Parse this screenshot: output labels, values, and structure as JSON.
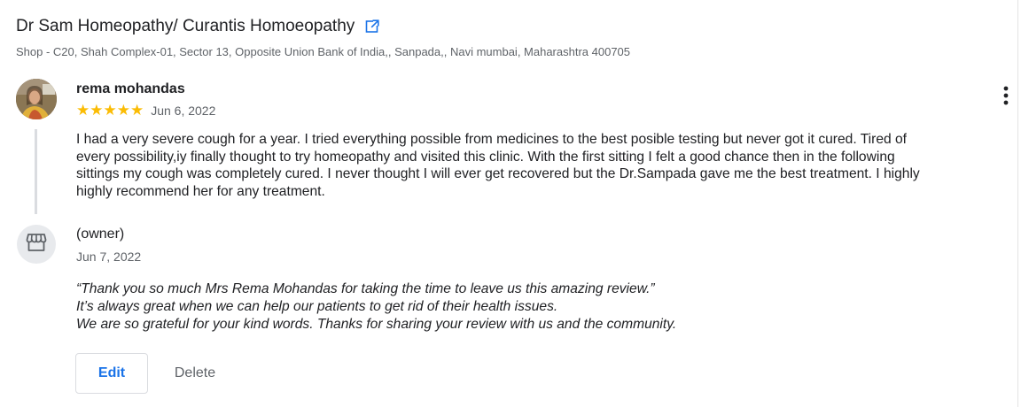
{
  "business": {
    "name": "Dr Sam Homeopathy/ Curantis Homoeopathy",
    "address": "Shop - C20, Shah Complex-01, Sector 13, Opposite Union Bank of India,, Sanpada,, Navi mumbai, Maharashtra 400705",
    "open_icon": "open-in-new-icon"
  },
  "review": {
    "reviewer_name": "rema mohandas",
    "stars_display": "★★★★★",
    "rating": 5,
    "date": "Jun 6, 2022",
    "text": "I had a very severe cough for a year. I tried everything possible from medicines to the best posible testing but never got it cured. Tired of every possibility,iy finally thought to try homeopathy and visited this clinic. With the first sitting I felt a good chance then in the following sittings my cough was completely cured. I never thought I will ever get recovered but the Dr.Sampada gave me the best treatment. I highly highly recommend her for any treatment.",
    "more_icon": "more-vert-icon"
  },
  "owner_reply": {
    "label": "(owner)",
    "date": "Jun 7, 2022",
    "icon": "storefront-icon",
    "lines": [
      "“Thank you so much Mrs Rema Mohandas for taking the time to leave us this amazing review.”",
      "It’s always great when we can help our patients to get rid of their health issues.",
      "We are so grateful for your kind words. Thanks for sharing your review with us and the community."
    ]
  },
  "actions": {
    "edit_label": "Edit",
    "delete_label": "Delete"
  },
  "colors": {
    "star": "#fbbc04",
    "link_blue": "#1a73e8",
    "secondary_text": "#5f6368"
  }
}
